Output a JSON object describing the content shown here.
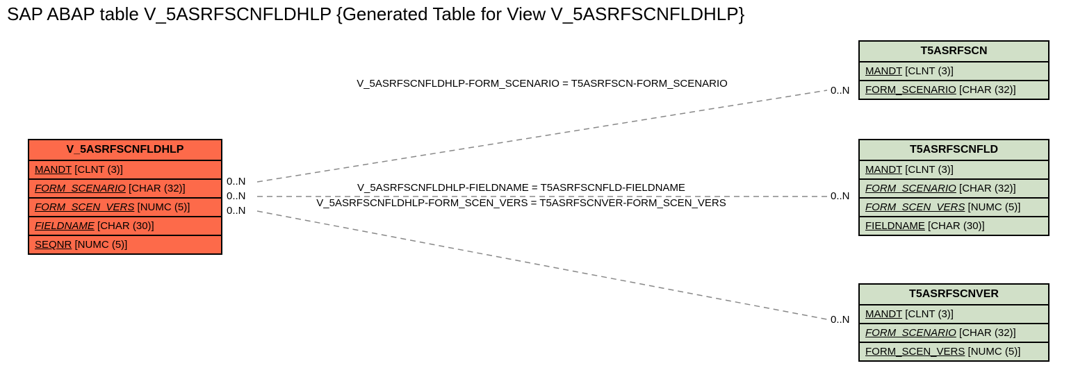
{
  "title": "SAP ABAP table V_5ASRFSCNFLDHLP {Generated Table for View V_5ASRFSCNFLDHLP}",
  "entities": {
    "main": {
      "name": "V_5ASRFSCNFLDHLP",
      "fields": [
        {
          "name": "MANDT",
          "type": "[CLNT (3)]",
          "italic": false
        },
        {
          "name": "FORM_SCENARIO",
          "type": "[CHAR (32)]",
          "italic": true
        },
        {
          "name": "FORM_SCEN_VERS",
          "type": "[NUMC (5)]",
          "italic": true
        },
        {
          "name": "FIELDNAME",
          "type": "[CHAR (30)]",
          "italic": true
        },
        {
          "name": "SEQNR",
          "type": "[NUMC (5)]",
          "italic": false
        }
      ]
    },
    "t1": {
      "name": "T5ASRFSCN",
      "fields": [
        {
          "name": "MANDT",
          "type": "[CLNT (3)]",
          "italic": false
        },
        {
          "name": "FORM_SCENARIO",
          "type": "[CHAR (32)]",
          "italic": false
        }
      ]
    },
    "t2": {
      "name": "T5ASRFSCNFLD",
      "fields": [
        {
          "name": "MANDT",
          "type": "[CLNT (3)]",
          "italic": false
        },
        {
          "name": "FORM_SCENARIO",
          "type": "[CHAR (32)]",
          "italic": true
        },
        {
          "name": "FORM_SCEN_VERS",
          "type": "[NUMC (5)]",
          "italic": true
        },
        {
          "name": "FIELDNAME",
          "type": "[CHAR (30)]",
          "italic": false
        }
      ]
    },
    "t3": {
      "name": "T5ASRFSCNVER",
      "fields": [
        {
          "name": "MANDT",
          "type": "[CLNT (3)]",
          "italic": false
        },
        {
          "name": "FORM_SCENARIO",
          "type": "[CHAR (32)]",
          "italic": true
        },
        {
          "name": "FORM_SCEN_VERS",
          "type": "[NUMC (5)]",
          "italic": false
        }
      ]
    }
  },
  "edge_labels": {
    "e1": "V_5ASRFSCNFLDHLP-FORM_SCENARIO = T5ASRFSCN-FORM_SCENARIO",
    "e2": "V_5ASRFSCNFLDHLP-FIELDNAME = T5ASRFSCNFLD-FIELDNAME",
    "e3": "V_5ASRFSCNFLDHLP-FORM_SCEN_VERS = T5ASRFSCNVER-FORM_SCEN_VERS"
  },
  "cards": {
    "left1": "0..N",
    "left2": "0..N",
    "left3": "0..N",
    "right1": "0..N",
    "right2": "0..N",
    "right3": "0..N"
  }
}
